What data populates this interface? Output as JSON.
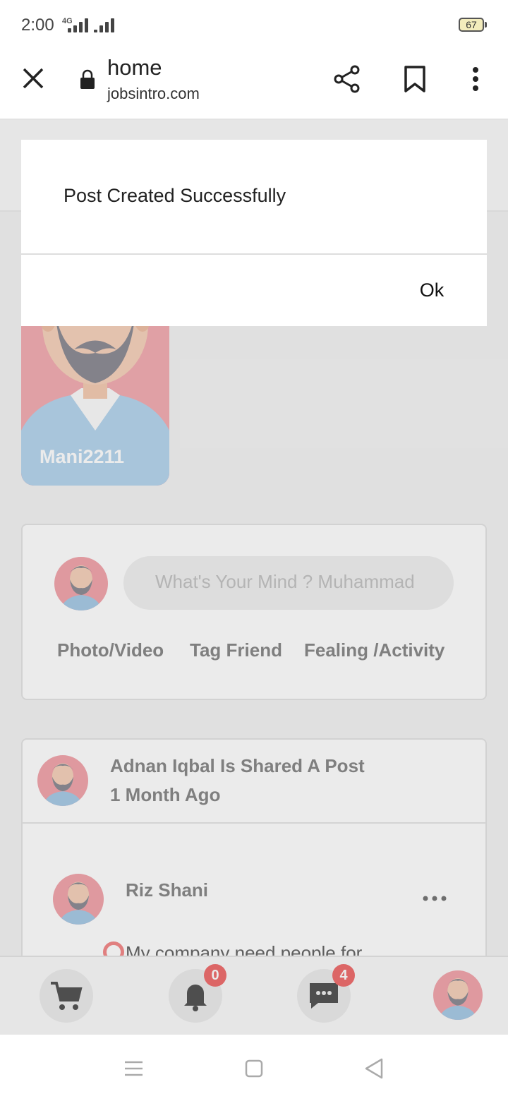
{
  "status_bar": {
    "time": "2:00",
    "network": "4G",
    "battery": "67"
  },
  "browser": {
    "title": "home",
    "domain": "jobsintro.com"
  },
  "story": {
    "username": "Mani2211"
  },
  "composer": {
    "placeholder": "What's Your Mind ? Muhammad",
    "actions": [
      "Photo/Video",
      "Tag Friend",
      "Fealing /Activity"
    ]
  },
  "feed_post": {
    "header": "Adnan Iqbal Is Shared A Post",
    "time": "1 Month Ago",
    "inner_author": "Riz Shani",
    "inner_text": "My company need people for"
  },
  "bottom_nav": {
    "notifications_count": "0",
    "messages_count": "4"
  },
  "dialog": {
    "message": "Post Created Successfully",
    "ok_label": "Ok"
  },
  "colors": {
    "badge": "#ef6f6f",
    "avatar_bg": "#f2a6ad",
    "shirt": "#a9cbe6"
  }
}
